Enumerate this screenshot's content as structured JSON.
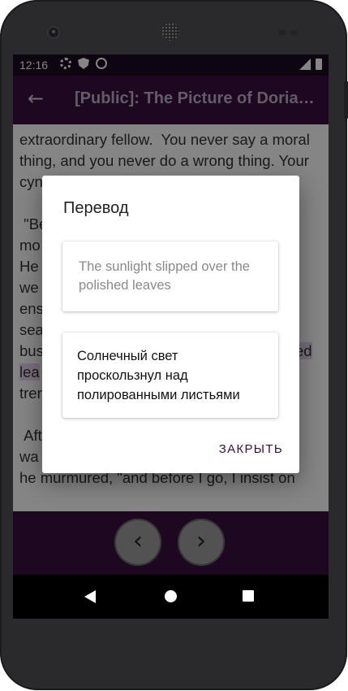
{
  "status_bar": {
    "time": "12:16"
  },
  "app_bar": {
    "title": "[Public]: The Picture of Dorian Gray"
  },
  "reader": {
    "lines": [
      "extraordinary fellow.  You never say a moral",
      "thing, and you never do a wrong thing. Your",
      "cyn",
      "",
      " \"Be",
      "mo",
      "He",
      "we",
      "ens",
      "sea",
      "bus",
      "lea",
      "trer",
      "",
      " Aft",
      "wa",
      "he murmured, \"and before I go, I insist on"
    ],
    "highlight_right": "ed"
  },
  "dialog": {
    "title": "Перевод",
    "source_text": "The sunlight slipped over the polished leaves",
    "translation_text": "Солнечный свет проскользнул над полированными листьями",
    "close_label": "ЗАКРЫТЬ"
  },
  "bottom_nav": {
    "prev_symbol": "‹",
    "next_symbol": "›"
  },
  "colors": {
    "app_bar": "#3a0e40",
    "status_bar": "#1a0a1e",
    "highlight": "#e9d3ef",
    "accent": "#3a0e40"
  },
  "icons": [
    "settings-gear-icon",
    "shield-icon",
    "at-sign-icon",
    "signal-icon",
    "battery-icon",
    "back-arrow-icon"
  ]
}
